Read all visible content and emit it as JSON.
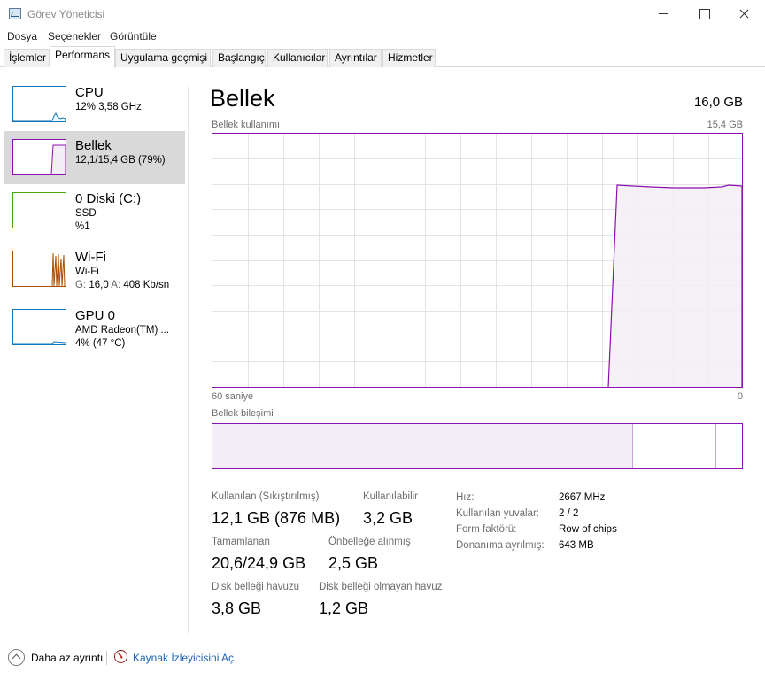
{
  "window": {
    "title": "Görev Yöneticisi"
  },
  "menu": [
    "Dosya",
    "Seçenekler",
    "Görüntüle"
  ],
  "tabs": [
    "İşlemler",
    "Performans",
    "Uygulama geçmişi",
    "Başlangıç",
    "Kullanıcılar",
    "Ayrıntılar",
    "Hizmetler"
  ],
  "active_tab": "Performans",
  "sidebar": {
    "cpu": {
      "title": "CPU",
      "line1": "12%  3,58 GHz",
      "color": "#1177bb"
    },
    "memory": {
      "title": "Bellek",
      "line1": "12,1/15,4 GB (79%)",
      "color": "#8b12ae"
    },
    "disk": {
      "title": "0 Diski (C:)",
      "line1": "SSD",
      "line2": "%1",
      "color": "#4da60c"
    },
    "wifi": {
      "title": "Wi-Fi",
      "line1": "Wi-Fi",
      "send_label": "G:",
      "send_value": "16,0",
      "recv_label": "A:",
      "recv_value": "408 Kb/sn",
      "color": "#a74f01"
    },
    "gpu": {
      "title": "GPU 0",
      "line1": "AMD Radeon(TM) ...",
      "line2": "4% (47 °C)",
      "color": "#1177bb"
    }
  },
  "main": {
    "title": "Bellek",
    "total": "16,0 GB",
    "usage_label": "Bellek kullanımı",
    "usage_max": "15,4 GB",
    "time_left": "60 saniye",
    "time_right": "0",
    "composition_label": "Bellek bileşimi",
    "usage_fraction": 0.79,
    "stats": {
      "in_use_label": "Kullanılan (Sıkıştırılmış)",
      "in_use_value": "12,1 GB (876 MB)",
      "available_label": "Kullanılabilir",
      "available_value": "3,2 GB",
      "committed_label": "Tamamlanan",
      "committed_value": "20,6/24,9 GB",
      "cached_label": "Önbelleğe alınmış",
      "cached_value": "2,5 GB",
      "paged_label": "Disk belleği havuzu",
      "paged_value": "3,8 GB",
      "nonpaged_label": "Disk belleği olmayan havuz",
      "nonpaged_value": "1,2 GB"
    },
    "props": {
      "speed_label": "Hız:",
      "speed_value": "2667 MHz",
      "slots_label": "Kullanılan yuvalar:",
      "slots_value": "2 / 2",
      "form_label": "Form faktörü:",
      "form_value": "Row of chips",
      "reserved_label": "Donanıma ayrılmış:",
      "reserved_value": "643 MB"
    }
  },
  "footer": {
    "fewer_details": "Daha az ayrıntı",
    "resource_monitor": "Kaynak İzleyicisini Aç"
  },
  "icons": {
    "app": "task-manager-icon",
    "fewer": "chevron-up-icon",
    "resmon": "resource-monitor-icon"
  }
}
